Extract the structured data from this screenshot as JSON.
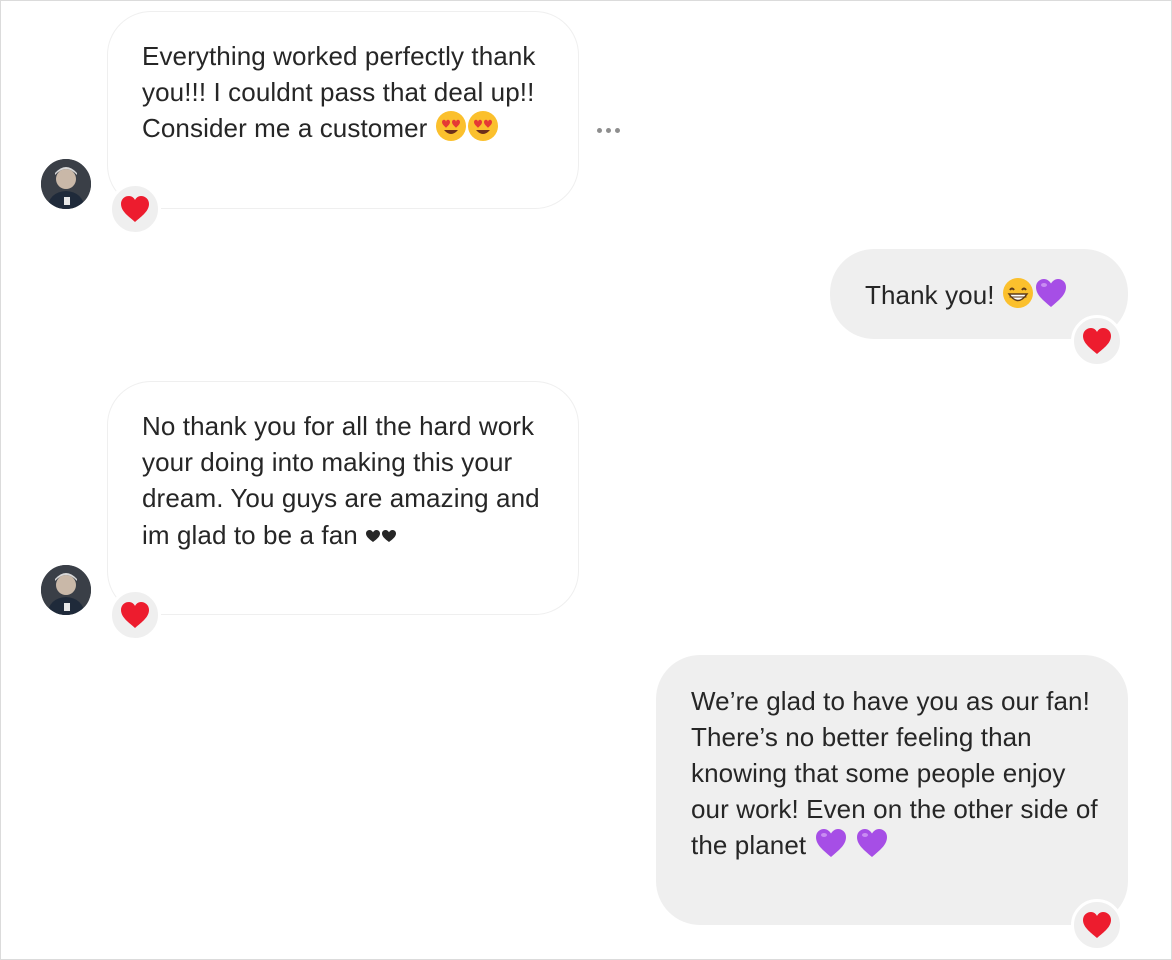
{
  "thread": {
    "messages": [
      {
        "direction": "incoming",
        "text": "Everything worked perfectly thank you!!! I couldnt pass that deal up!! Consider me a customer",
        "trailing_emojis": [
          "heart-eyes-emoji",
          "heart-eyes-emoji"
        ],
        "reaction": "red-heart-emoji"
      },
      {
        "direction": "outgoing",
        "text": "Thank you!",
        "trailing_emojis": [
          "grinning-emoji",
          "purple-heart-emoji"
        ],
        "reaction": "red-heart-emoji"
      },
      {
        "direction": "incoming",
        "text": "No thank you for all the hard work your doing into making this your dream. You guys are amazing and im glad to be a fan",
        "trailing_emojis": [
          "black-heart-glyph",
          "black-heart-glyph"
        ],
        "reaction": "red-heart-emoji"
      },
      {
        "direction": "outgoing",
        "text": "We’re glad to have you as our fan! There’s no better feeling than knowing that some people enjoy our work! Even on the other side of the planet",
        "trailing_emojis": [
          "purple-heart-emoji",
          "purple-heart-emoji"
        ],
        "reaction": "red-heart-emoji"
      }
    ]
  },
  "colors": {
    "incoming_bubble_border": "#efefef",
    "outgoing_bubble_bg": "#efefef",
    "text": "#262626",
    "reaction_heart": "#ed1c2e",
    "purple_heart": "#a64ee6",
    "more_dots": "#8e8e8e"
  }
}
